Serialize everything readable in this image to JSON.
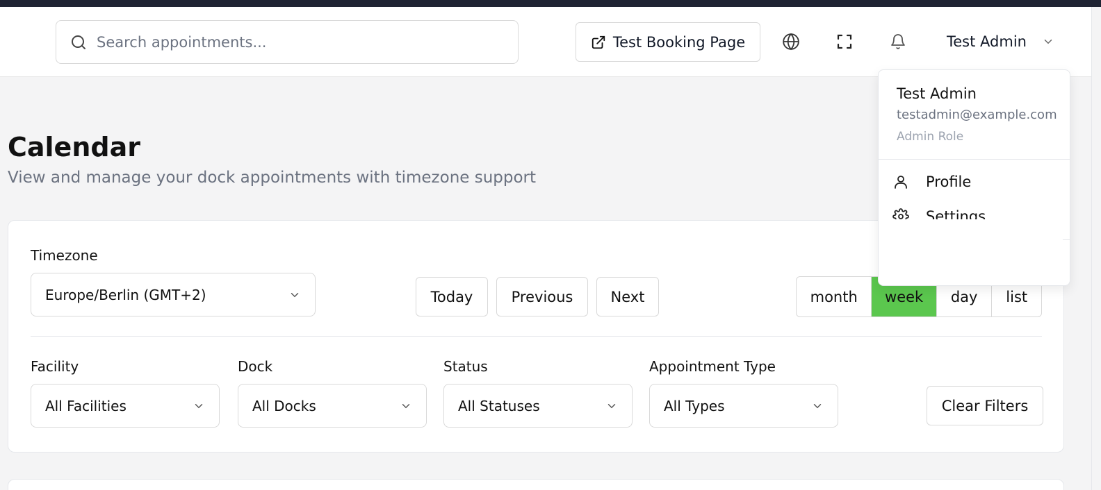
{
  "search": {
    "placeholder": "Search appointments..."
  },
  "header": {
    "booking_label": "Test Booking Page",
    "user_name": "Test Admin"
  },
  "user_menu": {
    "name": "Test Admin",
    "email": "testadmin@example.com",
    "role": "Admin Role",
    "items": [
      {
        "label": "Profile",
        "icon": "user-icon"
      },
      {
        "label": "Settings",
        "icon": "gear-icon"
      }
    ]
  },
  "page": {
    "title": "Calendar",
    "subtitle": "View and manage your dock appointments with timezone support"
  },
  "controls": {
    "timezone_label": "Timezone",
    "timezone_value": "Europe/Berlin (GMT+2)",
    "today": "Today",
    "previous": "Previous",
    "next": "Next",
    "views": [
      "month",
      "week",
      "day",
      "list"
    ],
    "active_view": "week"
  },
  "filters": {
    "facility_label": "Facility",
    "facility_value": "All Facilities",
    "dock_label": "Dock",
    "dock_value": "All Docks",
    "status_label": "Status",
    "status_value": "All Statuses",
    "type_label": "Appointment Type",
    "type_value": "All Types",
    "clear": "Clear Filters"
  },
  "colors": {
    "accent": "#5bc74e",
    "header_strip": "#1f2433"
  }
}
